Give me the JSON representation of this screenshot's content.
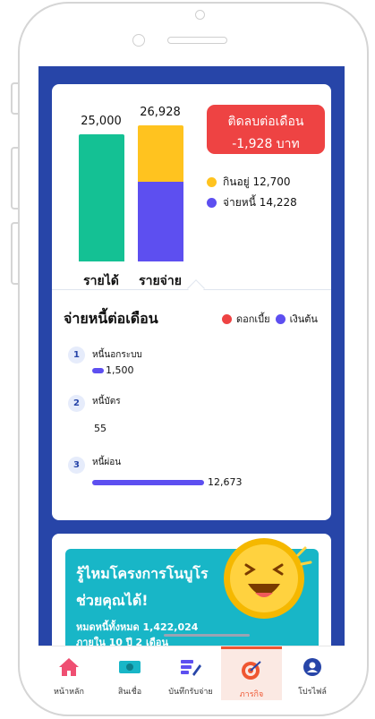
{
  "summary": {
    "income_value": "25,000",
    "expense_value": "26,928",
    "income_label": "รายได้",
    "expense_label": "รายจ่าย",
    "deficit_line1": "ติดลบต่อเดือน",
    "deficit_line2": "-1,928 บาท",
    "legend_food": "กินอยู่ 12,700",
    "legend_debt": "จ่ายหนี้ 14,228",
    "colors": {
      "income": "#14c194",
      "food": "#ffc31f",
      "debt": "#5d4ff0",
      "deficit": "#ee4343"
    }
  },
  "debt_section": {
    "title": "จ่ายหนี้ต่อเดือน",
    "legend_interest": "ดอกเบี้ย",
    "legend_principal": "เงินต้น",
    "items": [
      {
        "num": "1",
        "name": "หนี้นอกระบบ",
        "value": "1,500"
      },
      {
        "num": "2",
        "name": "หนี้บัตร",
        "value": "55"
      },
      {
        "num": "3",
        "name": "หนี้ผ่อน",
        "value": "12,673"
      }
    ]
  },
  "promo": {
    "title1": "รู้ไหมโครงการโนบูโร",
    "title2": "ช่วยคุณได้!",
    "sub1": "หมดหนี้ทั้งหมด 1,422,024",
    "sub2": "ภายใน 10 ปี 2 เดือน"
  },
  "tabbar": {
    "tabs": [
      {
        "label": "หน้าหลัก",
        "icon": "home-icon"
      },
      {
        "label": "สินเชื่อ",
        "icon": "cash-icon"
      },
      {
        "label": "บันทึกรับจ่าย",
        "icon": "notebook-pen-icon"
      },
      {
        "label": "ภารกิจ",
        "icon": "target-icon"
      },
      {
        "label": "โปรไฟล์",
        "icon": "user-icon"
      }
    ],
    "active": "ภารกิจ"
  }
}
